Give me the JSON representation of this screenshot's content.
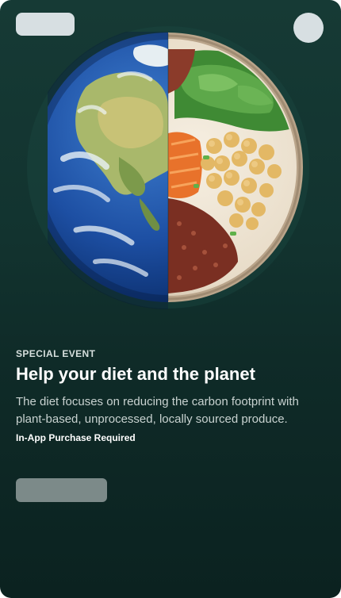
{
  "card": {
    "eyebrow": "SPECIAL EVENT",
    "title": "Help your diet and the planet",
    "description": "The diet focuses on reducing the carbon footprint with plant-based, unprocessed, locally sourced produce.",
    "purchase_note": "In-App Purchase Required"
  },
  "colors": {
    "background": "#12332f",
    "placeholder": "#d7dfe2",
    "button": "#7c8a89"
  }
}
